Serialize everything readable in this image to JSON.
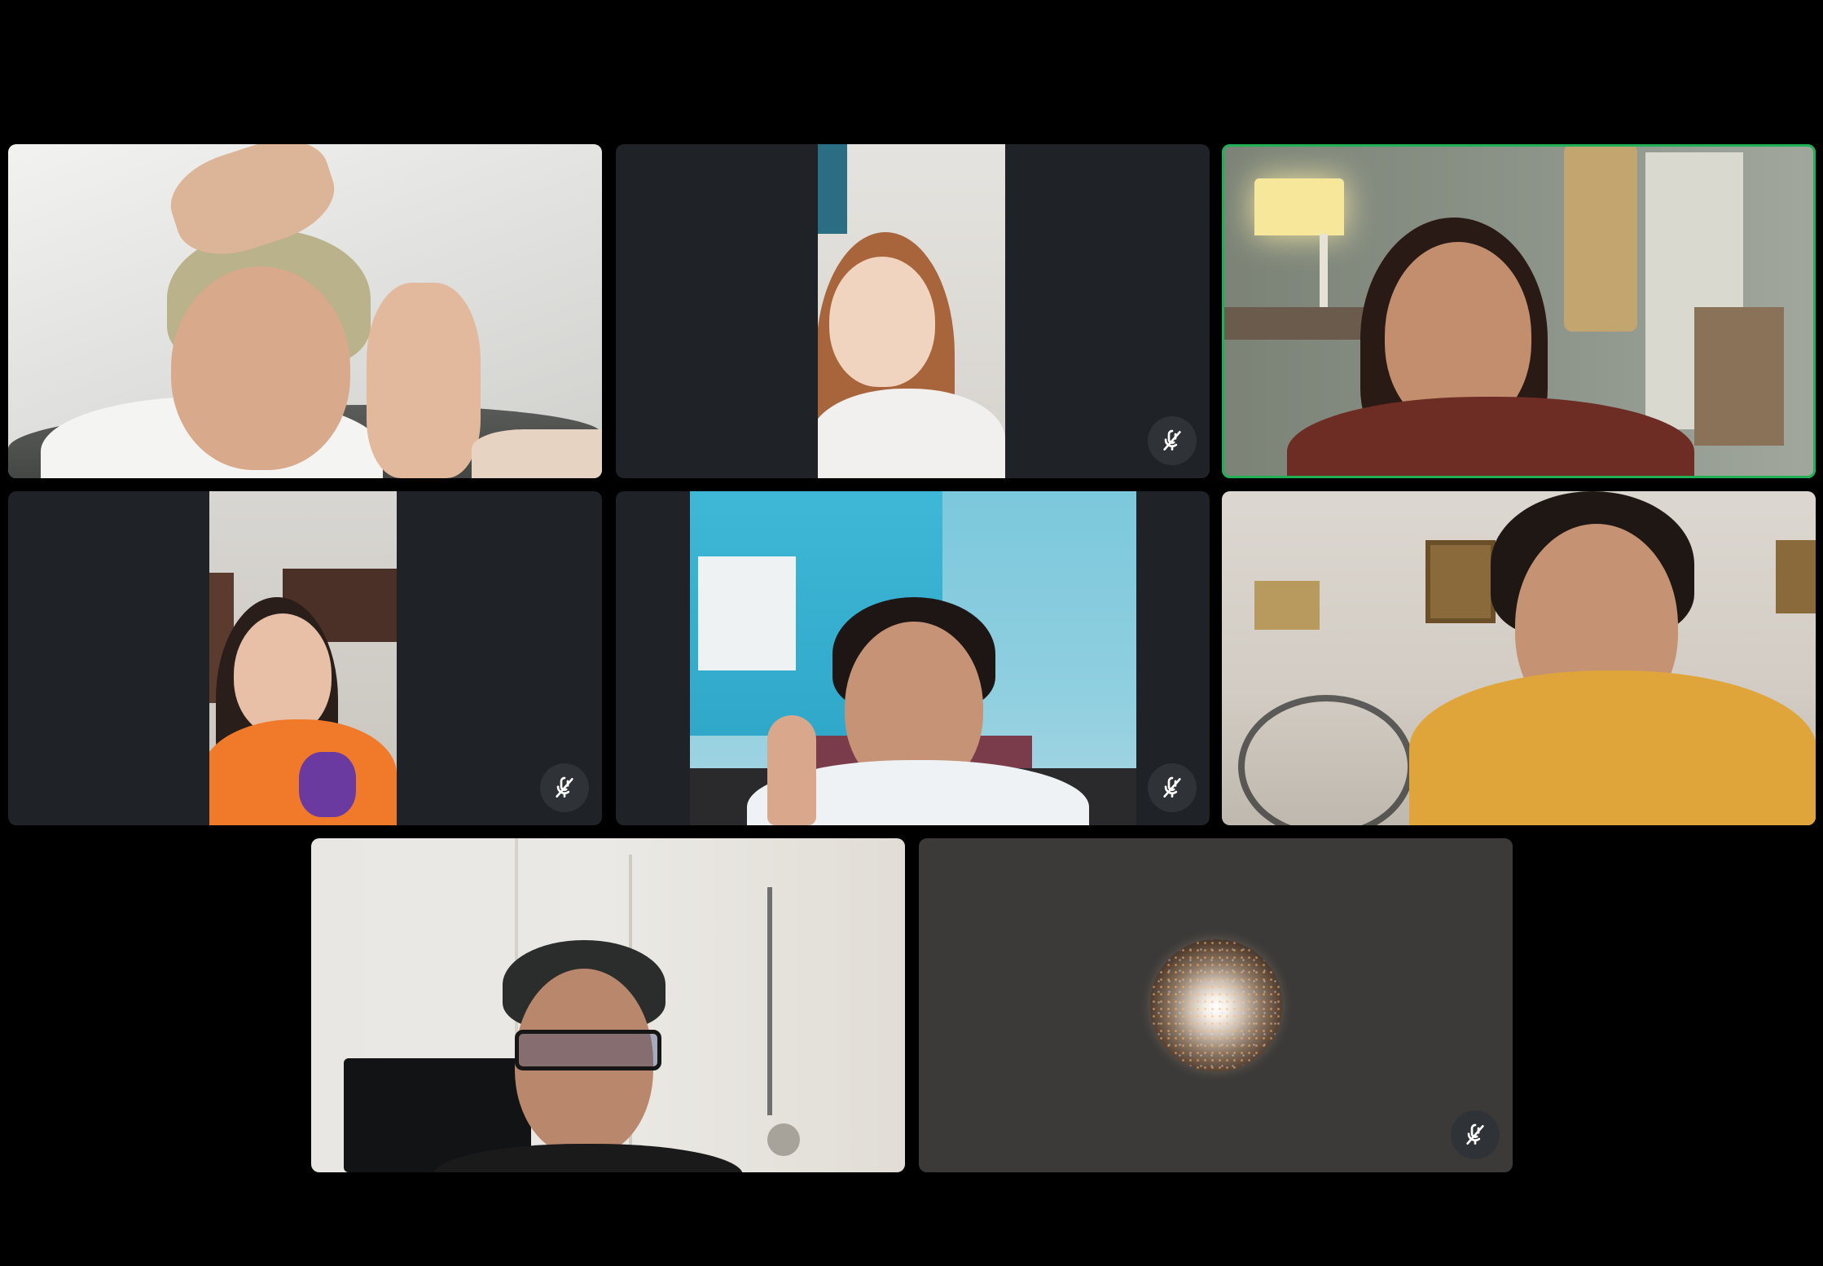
{
  "meeting": {
    "layout": "grid",
    "speaking_border_color": "#20b157",
    "tile_background": "#1f2226",
    "avatar_tile_background": "#3c3a38"
  },
  "participants": [
    {
      "tile": 1,
      "video": "on",
      "muted": false,
      "speaking": false
    },
    {
      "tile": 2,
      "video": "on",
      "muted": true,
      "speaking": false,
      "muted_icon": "mic-off-icon"
    },
    {
      "tile": 3,
      "video": "on",
      "muted": false,
      "speaking": true
    },
    {
      "tile": 4,
      "video": "on",
      "muted": true,
      "speaking": false,
      "muted_icon": "mic-off-icon"
    },
    {
      "tile": 5,
      "video": "on",
      "muted": true,
      "speaking": false,
      "muted_icon": "mic-off-icon"
    },
    {
      "tile": 6,
      "video": "on",
      "muted": false,
      "speaking": false
    },
    {
      "tile": 7,
      "video": "on",
      "muted": false,
      "speaking": false
    },
    {
      "tile": 8,
      "video": "off",
      "muted": true,
      "speaking": false,
      "muted_icon": "mic-off-icon",
      "avatar_icon": "star-cluster-avatar-icon"
    }
  ]
}
